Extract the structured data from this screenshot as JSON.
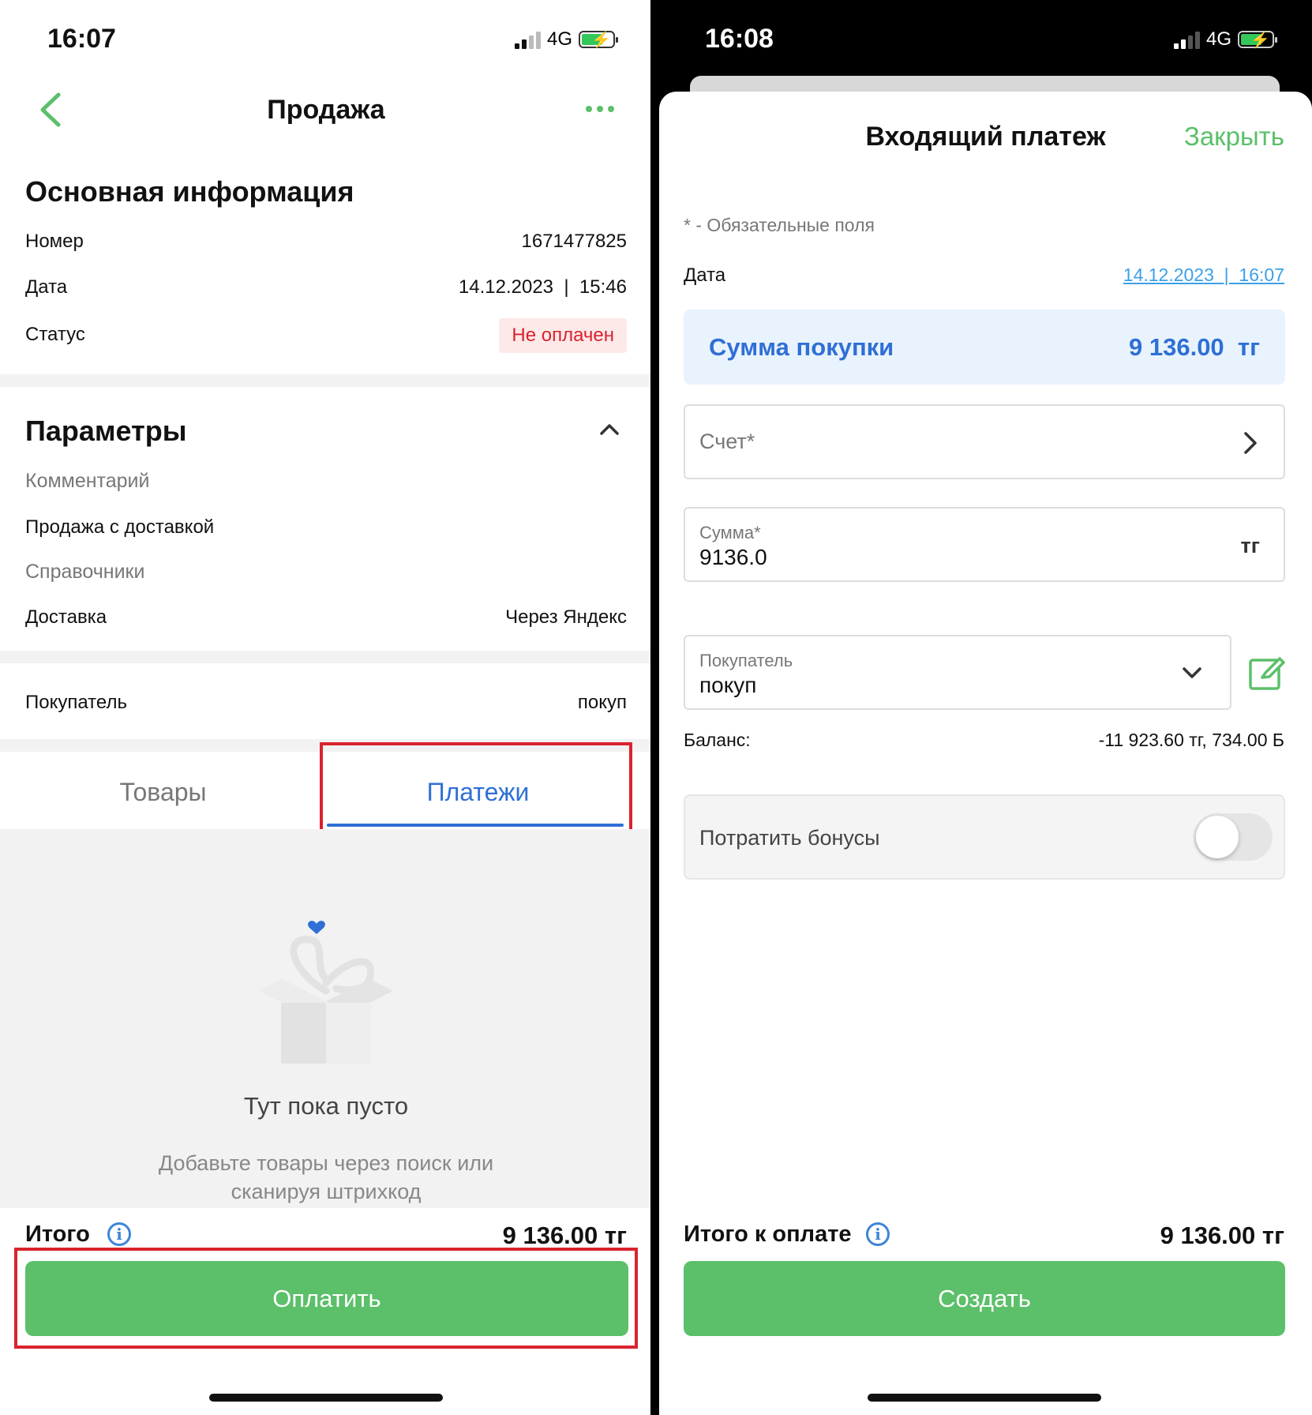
{
  "left": {
    "status_time": "16:07",
    "network": "4G",
    "title": "Продажа",
    "basic_section_title": "Основная информация",
    "rows": [
      {
        "label": "Номер",
        "value": "1671477825"
      },
      {
        "label": "Дата",
        "value": "14.12.2023  |  15:46"
      },
      {
        "label": "Статус",
        "value": "Не оплачен"
      }
    ],
    "params_title": "Параметры",
    "comment_label": "Комментарий",
    "comment_value": "Продажа с доставкой",
    "refs_label": "Справочники",
    "delivery_label": "Доставка",
    "delivery_value": "Через Яндекс",
    "buyer_label": "Покупатель",
    "buyer_value": "покуп",
    "tabs": [
      {
        "label": "Товары"
      },
      {
        "label": "Платежи"
      }
    ],
    "empty_title": "Тут пока пусто",
    "empty_subtitle_1": "Добавьте товары через поиск или",
    "empty_subtitle_2": "сканируя штрихкод",
    "total_label": "Итого",
    "total_value": "9 136.00 тг",
    "pay_button": "Оплатить"
  },
  "right": {
    "status_time": "16:08",
    "network": "4G",
    "title": "Входящий платеж",
    "close_label": "Закрыть",
    "required_note": "* - Обязательные поля",
    "date_label": "Дата",
    "date_value": "14.12.2023  |  16:07",
    "purchase_label": "Сумма покупки",
    "purchase_value": "9 136.00  тг",
    "account_placeholder": "Счет*",
    "sum_label": "Сумма*",
    "sum_value": "9136.0",
    "sum_currency": "тг",
    "buyer_label": "Покупатель",
    "buyer_value": "покуп",
    "balance_label": "Баланс:",
    "balance_value": "-11 923.60 тг, 734.00 Б",
    "bonus_label": "Потратить бонусы",
    "bonus_enabled": false,
    "total_label": "Итого к оплате",
    "total_value": "9 136.00 тг",
    "create_button": "Создать"
  },
  "colors": {
    "accent_green": "#5cbf6a",
    "accent_blue": "#2f6fd6",
    "status_red": "#d9232e"
  }
}
